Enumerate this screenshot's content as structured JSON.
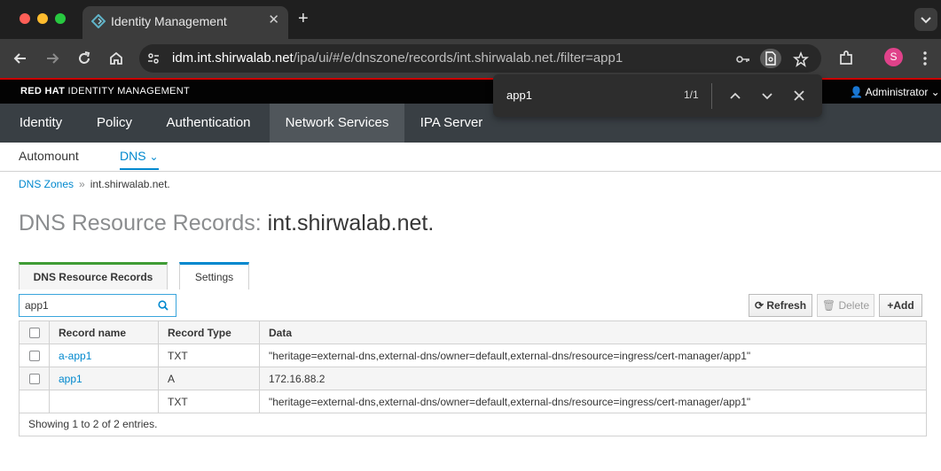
{
  "browser": {
    "tab_title": "Identity Management",
    "url_host": "idm.int.shirwalab.net",
    "url_path": "/ipa/ui/#/e/dnszone/records/int.shirwalab.net./filter=app1",
    "profile_initial": "S"
  },
  "find": {
    "query": "app1",
    "count": "1/1"
  },
  "header": {
    "brand_bold": "RED HAT",
    "brand_rest": " IDENTITY MANAGEMENT",
    "user": "Administrator"
  },
  "nav": {
    "items": [
      "Identity",
      "Policy",
      "Authentication",
      "Network Services",
      "IPA Server"
    ],
    "active": "Network Services"
  },
  "subnav": {
    "items": [
      "Automount",
      "DNS"
    ],
    "active": "DNS"
  },
  "breadcrumb": {
    "link": "DNS Zones",
    "separator": "»",
    "current": "int.shirwalab.net."
  },
  "page": {
    "title_prefix": "DNS Resource Records:",
    "zone": "int.shirwalab.net."
  },
  "tabs": {
    "records": "DNS Resource Records",
    "settings": "Settings"
  },
  "search": {
    "value": "app1"
  },
  "buttons": {
    "refresh": "Refresh",
    "delete": "Delete",
    "add": "Add"
  },
  "table": {
    "headers": [
      "Record name",
      "Record Type",
      "Data"
    ],
    "rows": [
      {
        "name": "a-app1",
        "type": "TXT",
        "data": "\"heritage=external-dns,external-dns/owner=default,external-dns/resource=ingress/cert-manager/app1\""
      },
      {
        "name": "app1",
        "type": "A",
        "data": "172.16.88.2"
      },
      {
        "name": "",
        "type": "TXT",
        "data": "\"heritage=external-dns,external-dns/owner=default,external-dns/resource=ingress/cert-manager/app1\""
      }
    ],
    "footer": "Showing 1 to 2 of 2 entries."
  },
  "colors": {
    "accent": "#0088ce",
    "chrome_red": "#cc0000",
    "nav_bg": "#393f44",
    "nav_active": "#50565b"
  }
}
